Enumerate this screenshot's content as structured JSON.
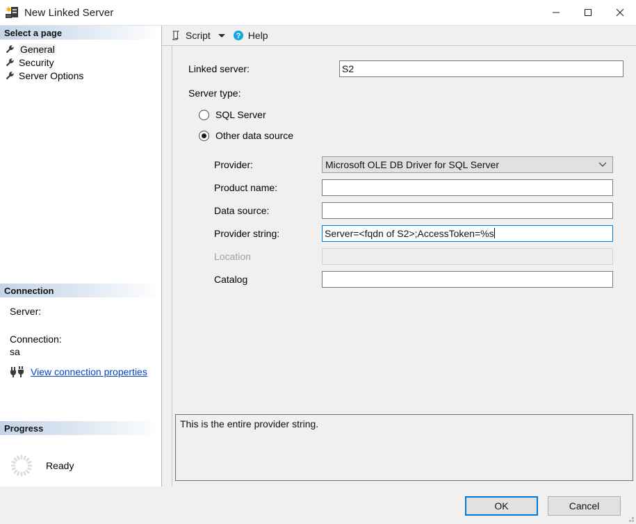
{
  "window": {
    "title": "New Linked Server",
    "app_icon": "new-linked-server-icon",
    "controls": {
      "minimize": "minimize-icon",
      "maximize": "maximize-icon",
      "close": "close-icon"
    }
  },
  "sidebar": {
    "header": "Select a page",
    "items": [
      {
        "label": "General",
        "icon": "wrench-icon",
        "selected": true
      },
      {
        "label": "Security",
        "icon": "wrench-icon",
        "selected": false
      },
      {
        "label": "Server Options",
        "icon": "wrench-icon",
        "selected": false
      }
    ],
    "connection": {
      "header": "Connection",
      "server_label": "Server:",
      "server_value": "",
      "connection_label": "Connection:",
      "connection_value": "sa",
      "link_label": "View connection properties",
      "link_icon": "connection-plug-icon"
    },
    "progress": {
      "header": "Progress",
      "status": "Ready",
      "icon": "spinner-icon"
    }
  },
  "toolbar": {
    "script_label": "Script",
    "script_icon": "script-icon",
    "script_caret": "chevron-down-icon",
    "help_label": "Help",
    "help_icon": "help-circle-icon"
  },
  "form": {
    "linked_server": {
      "label": "Linked server:",
      "value": "S2",
      "placeholder": ""
    },
    "server_type": {
      "label": "Server type:",
      "options": [
        {
          "label": "SQL Server",
          "selected": false
        },
        {
          "label": "Other data source",
          "selected": true
        }
      ]
    },
    "fields": [
      {
        "label": "Provider:",
        "type": "combobox",
        "value": "Microsoft OLE DB Driver for SQL Server",
        "disabled": false,
        "focused": false,
        "arrow_icon": "chevron-down-icon"
      },
      {
        "label": "Product name:",
        "type": "text",
        "value": "",
        "disabled": false,
        "focused": false
      },
      {
        "label": "Data source:",
        "type": "text",
        "value": "",
        "disabled": false,
        "focused": false
      },
      {
        "label": "Provider string:",
        "type": "text",
        "value": "Server=<fqdn of S2>;AccessToken=%s",
        "disabled": false,
        "focused": true
      },
      {
        "label": "Location",
        "type": "text",
        "value": "",
        "disabled": true,
        "focused": false
      },
      {
        "label": "Catalog",
        "type": "text",
        "value": "",
        "disabled": false,
        "focused": false
      }
    ],
    "description": "This is the entire provider string."
  },
  "footer": {
    "ok_label": "OK",
    "cancel_label": "Cancel"
  },
  "colors": {
    "accent": "#0078d7",
    "link": "#0645c4",
    "dialog_bg": "#f0f0f0",
    "header_gradient_start": "#c5d5e8"
  }
}
